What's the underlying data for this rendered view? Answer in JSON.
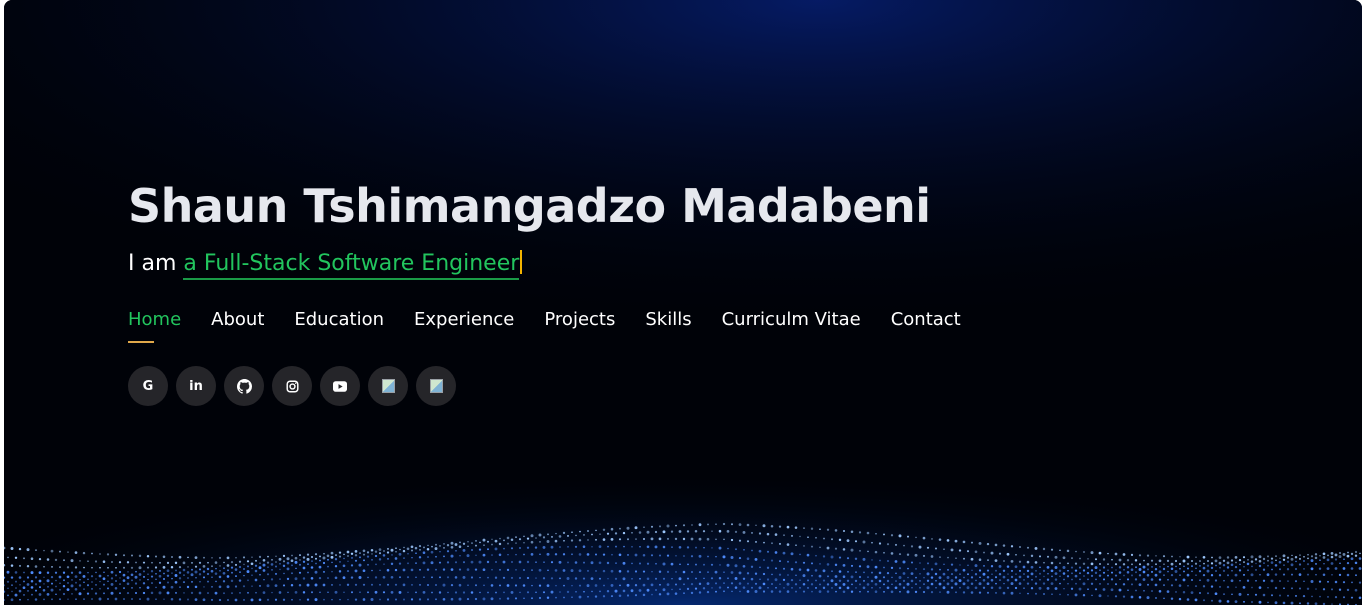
{
  "hero": {
    "name": "Shaun Tshimangadzo Madabeni",
    "tagline_prefix": "I am ",
    "tagline_typed": "a Full-Stack Software Engineer"
  },
  "nav": {
    "items": [
      {
        "label": "Home",
        "active": true
      },
      {
        "label": "About"
      },
      {
        "label": "Education"
      },
      {
        "label": "Experience"
      },
      {
        "label": "Projects"
      },
      {
        "label": "Skills"
      },
      {
        "label": "Curriculm Vitae"
      },
      {
        "label": "Contact"
      }
    ]
  },
  "social": {
    "links": [
      {
        "icon": "google-icon",
        "glyph": "G"
      },
      {
        "icon": "linkedin-icon",
        "glyph": "in"
      },
      {
        "icon": "github-icon"
      },
      {
        "icon": "instagram-icon"
      },
      {
        "icon": "youtube-icon"
      },
      {
        "icon": "broken-image-icon"
      },
      {
        "icon": "broken-image-icon"
      }
    ]
  },
  "colors": {
    "accent_green": "#22c55e",
    "underline_gold": "#e0a84a",
    "cursor": "#f4b400",
    "background": "#000208",
    "matrix_blue": "#1e5bff"
  }
}
